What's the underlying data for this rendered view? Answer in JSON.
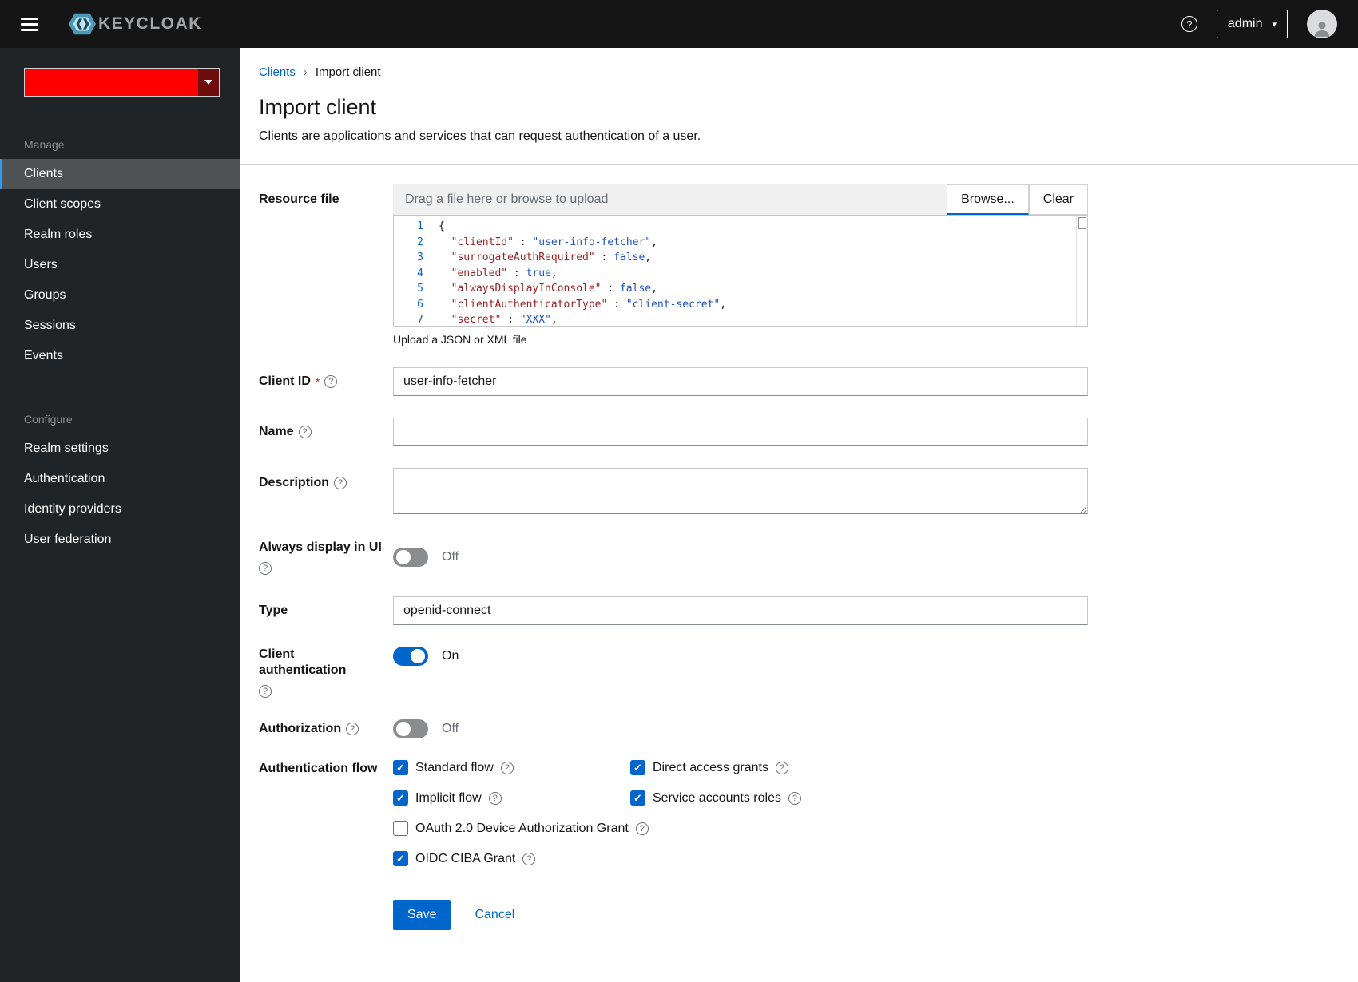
{
  "colors": {
    "accent": "#0066cc",
    "realm_red": "#ff0000",
    "topbar_bg": "#151515",
    "sidebar_bg": "#212427"
  },
  "icons": {
    "help": "?",
    "caret": "▾",
    "check": "✓",
    "breadcrumb_sep": "›"
  },
  "topbar": {
    "brand": "KEYCLOAK",
    "user_menu": "admin"
  },
  "sidebar": {
    "sections": [
      {
        "label": "Manage",
        "items": [
          {
            "label": "Clients",
            "active": true
          },
          {
            "label": "Client scopes",
            "active": false
          },
          {
            "label": "Realm roles",
            "active": false
          },
          {
            "label": "Users",
            "active": false
          },
          {
            "label": "Groups",
            "active": false
          },
          {
            "label": "Sessions",
            "active": false
          },
          {
            "label": "Events",
            "active": false
          }
        ]
      },
      {
        "label": "Configure",
        "items": [
          {
            "label": "Realm settings",
            "active": false
          },
          {
            "label": "Authentication",
            "active": false
          },
          {
            "label": "Identity providers",
            "active": false
          },
          {
            "label": "User federation",
            "active": false
          }
        ]
      }
    ]
  },
  "breadcrumb": {
    "parent": "Clients",
    "current": "Import client"
  },
  "page": {
    "title": "Import client",
    "subtitle": "Clients are applications and services that can request authentication of a user."
  },
  "form": {
    "resource_file": {
      "label": "Resource file",
      "placeholder": "Drag a file here or browse to upload",
      "browse": "Browse...",
      "clear": "Clear",
      "hint": "Upload a JSON or XML file",
      "code": [
        {
          "n": "1",
          "tokens": [
            [
              "{",
              "p"
            ]
          ]
        },
        {
          "n": "2",
          "tokens": [
            [
              "  ",
              "p"
            ],
            [
              "\"clientId\"",
              "k"
            ],
            [
              " : ",
              "p"
            ],
            [
              "\"user-info-fetcher\"",
              "s"
            ],
            [
              ",",
              "p"
            ]
          ]
        },
        {
          "n": "3",
          "tokens": [
            [
              "  ",
              "p"
            ],
            [
              "\"surrogateAuthRequired\"",
              "k"
            ],
            [
              " : ",
              "p"
            ],
            [
              "false",
              "a"
            ],
            [
              ",",
              "p"
            ]
          ]
        },
        {
          "n": "4",
          "tokens": [
            [
              "  ",
              "p"
            ],
            [
              "\"enabled\"",
              "k"
            ],
            [
              " : ",
              "p"
            ],
            [
              "true",
              "a"
            ],
            [
              ",",
              "p"
            ]
          ]
        },
        {
          "n": "5",
          "tokens": [
            [
              "  ",
              "p"
            ],
            [
              "\"alwaysDisplayInConsole\"",
              "k"
            ],
            [
              " : ",
              "p"
            ],
            [
              "false",
              "a"
            ],
            [
              ",",
              "p"
            ]
          ]
        },
        {
          "n": "6",
          "tokens": [
            [
              "  ",
              "p"
            ],
            [
              "\"clientAuthenticatorType\"",
              "k"
            ],
            [
              " : ",
              "p"
            ],
            [
              "\"client-secret\"",
              "s"
            ],
            [
              ",",
              "p"
            ]
          ]
        },
        {
          "n": "7",
          "tokens": [
            [
              "  ",
              "p"
            ],
            [
              "\"secret\"",
              "k"
            ],
            [
              " : ",
              "p"
            ],
            [
              "\"XXX\"",
              "s"
            ],
            [
              ",",
              "p"
            ]
          ]
        }
      ]
    },
    "client_id": {
      "label": "Client ID",
      "required": "*",
      "value": "user-info-fetcher"
    },
    "name": {
      "label": "Name",
      "value": ""
    },
    "description": {
      "label": "Description",
      "value": ""
    },
    "always_display": {
      "label": "Always display in UI",
      "state": "Off"
    },
    "type": {
      "label": "Type",
      "value": "openid-connect"
    },
    "client_auth": {
      "label": "Client authentication",
      "state": "On"
    },
    "authorization": {
      "label": "Authorization",
      "state": "Off"
    },
    "auth_flow": {
      "label": "Authentication flow",
      "options": [
        {
          "label": "Standard flow",
          "checked": true
        },
        {
          "label": "Direct access grants",
          "checked": true
        },
        {
          "label": "Implicit flow",
          "checked": true
        },
        {
          "label": "Service accounts roles",
          "checked": true
        },
        {
          "label": "OAuth 2.0 Device Authorization Grant",
          "checked": false
        },
        {
          "label": "OIDC CIBA Grant",
          "checked": true
        }
      ]
    },
    "actions": {
      "save": "Save",
      "cancel": "Cancel"
    }
  }
}
